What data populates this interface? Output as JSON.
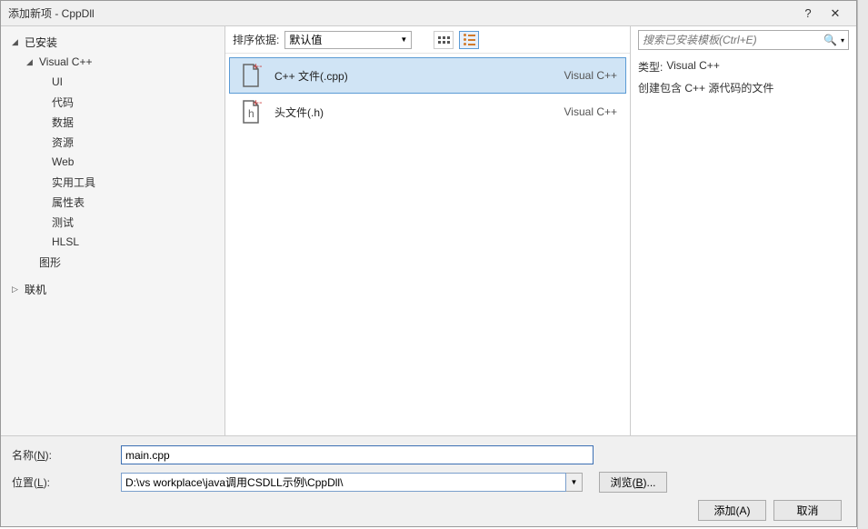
{
  "title": "添加新项 - CppDll",
  "titlebar": {
    "help": "?",
    "close": "✕"
  },
  "sidebar": {
    "installed": "已安装",
    "vcpp": "Visual C++",
    "children": [
      "UI",
      "代码",
      "数据",
      "资源",
      "Web",
      "实用工具",
      "属性表",
      "测试",
      "HLSL"
    ],
    "graphics": "图形",
    "online": "联机"
  },
  "toolbar": {
    "sort_label": "排序依据:",
    "sort_value": "默认值"
  },
  "items": [
    {
      "name": "C++ 文件(.cpp)",
      "lang": "Visual C++",
      "icon": "cpp"
    },
    {
      "name": "头文件(.h)",
      "lang": "Visual C++",
      "icon": "h"
    }
  ],
  "search": {
    "placeholder": "搜索已安装模板(Ctrl+E)"
  },
  "info": {
    "type_label": "类型:",
    "type_value": "Visual C++",
    "desc": "创建包含 C++ 源代码的文件"
  },
  "bottom": {
    "name_label_pre": "名称(",
    "name_label_u": "N",
    "name_label_post": "):",
    "name_value": "main.cpp",
    "loc_label_pre": "位置(",
    "loc_label_u": "L",
    "loc_label_post": "):",
    "loc_value": "D:\\vs workplace\\java调用CSDLL示例\\CppDll\\",
    "browse_pre": "浏览(",
    "browse_u": "B",
    "browse_post": ")...",
    "add_pre": "添加(",
    "add_u": "A",
    "add_post": ")",
    "cancel": "取消"
  }
}
